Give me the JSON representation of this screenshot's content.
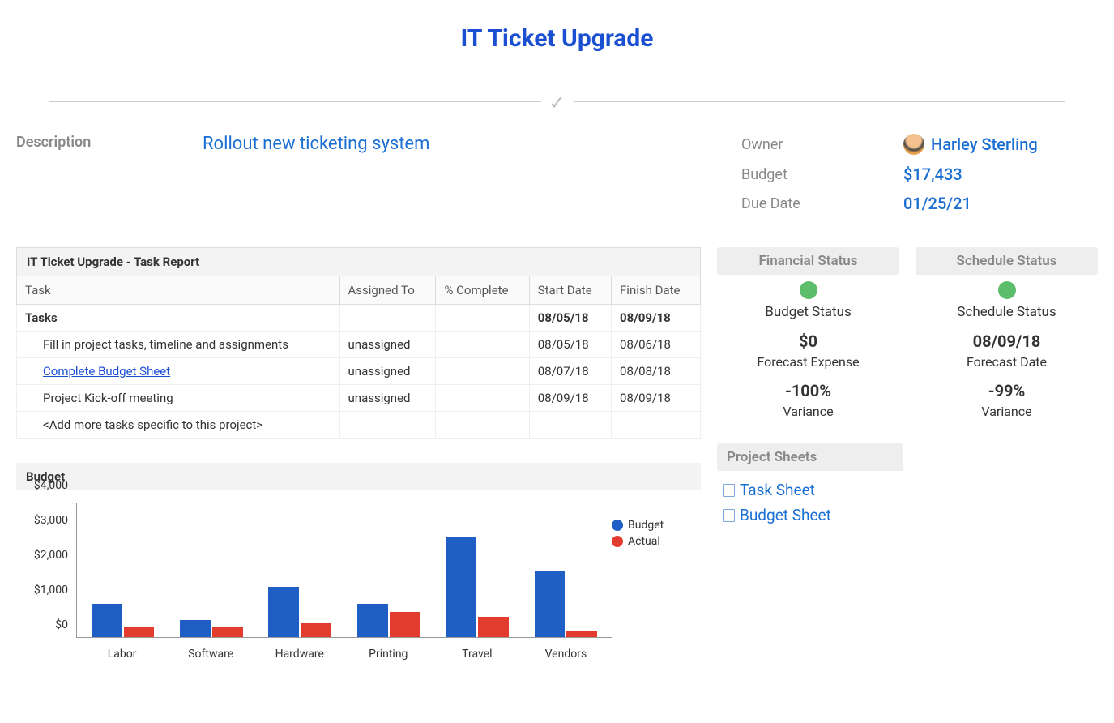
{
  "title": "IT Ticket Upgrade",
  "description_label": "Description",
  "description_value": "Rollout new ticketing system",
  "meta": {
    "owner_label": "Owner",
    "owner_value": "Harley Sterling",
    "budget_label": "Budget",
    "budget_value": "$17,433",
    "due_label": "Due Date",
    "due_value": "01/25/21"
  },
  "task_report": {
    "title": "IT Ticket Upgrade - Task Report",
    "headers": {
      "task": "Task",
      "assigned": "Assigned To",
      "complete": "% Complete",
      "start": "Start Date",
      "finish": "Finish Date"
    },
    "rows": [
      {
        "task": "Tasks",
        "assigned": "",
        "complete": "",
        "start": "08/05/18",
        "finish": "08/09/18",
        "bold": true
      },
      {
        "task": "Fill in project tasks, timeline and assignments",
        "assigned": "unassigned",
        "complete": "",
        "start": "08/05/18",
        "finish": "08/06/18",
        "indent": true
      },
      {
        "task": "Complete Budget Sheet",
        "assigned": "unassigned",
        "complete": "",
        "start": "08/07/18",
        "finish": "08/08/18",
        "indent": true,
        "link": true
      },
      {
        "task": "Project Kick-off meeting",
        "assigned": "unassigned",
        "complete": "",
        "start": "08/09/18",
        "finish": "08/09/18",
        "indent": true
      },
      {
        "task": "<Add more tasks specific to this project>",
        "assigned": "",
        "complete": "",
        "start": "",
        "finish": "",
        "indent": true
      }
    ]
  },
  "financial_status": {
    "header": "Financial Status",
    "status_label": "Budget Status",
    "expense_value": "$0",
    "expense_label": "Forecast Expense",
    "variance_value": "-100%",
    "variance_label": "Variance",
    "dot_color": "#5cbd6a"
  },
  "schedule_status": {
    "header": "Schedule Status",
    "status_label": "Schedule Status",
    "date_value": "08/09/18",
    "date_label": "Forecast Date",
    "variance_value": "-99%",
    "variance_label": "Variance",
    "dot_color": "#5cbd6a"
  },
  "project_sheets": {
    "header": "Project Sheets",
    "links": [
      "Task Sheet",
      "Budget Sheet"
    ]
  },
  "budget_section_title": "Budget",
  "chart_data": {
    "type": "bar",
    "title": "Budget",
    "categories": [
      "Labor",
      "Software",
      "Hardware",
      "Printing",
      "Travel",
      "Vendors"
    ],
    "series": [
      {
        "name": "Budget",
        "color": "#1f5fc5",
        "values": [
          1000,
          500,
          1500,
          1000,
          3000,
          2000
        ]
      },
      {
        "name": "Actual",
        "color": "#e13c2e",
        "values": [
          300,
          320,
          420,
          750,
          600,
          180
        ]
      }
    ],
    "ylim": [
      0,
      4000
    ],
    "yticks": [
      0,
      1000,
      2000,
      3000,
      4000
    ],
    "ytick_labels": [
      "$0",
      "$1,000",
      "$2,000",
      "$3,000",
      "$4,000"
    ],
    "xlabel": "",
    "ylabel": ""
  }
}
